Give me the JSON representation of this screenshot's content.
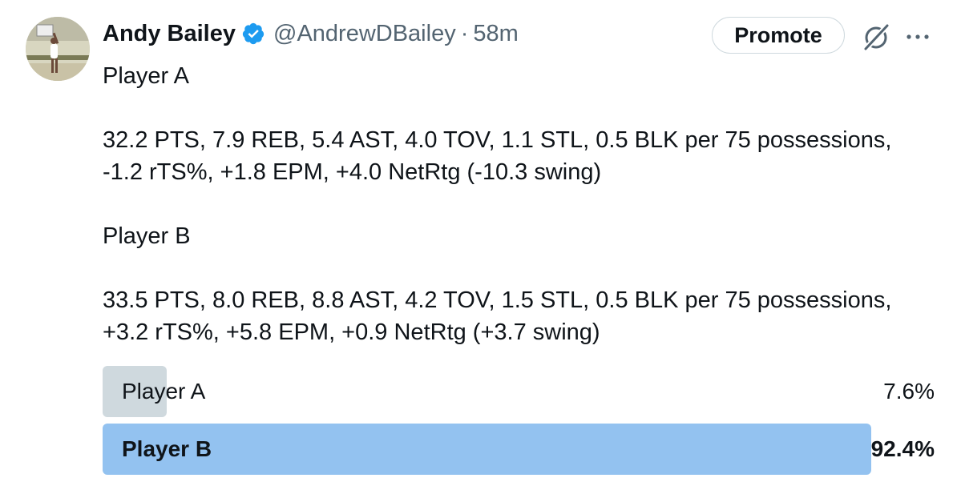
{
  "author": {
    "name": "Andy Bailey",
    "handle": "@AndrewDBailey",
    "separator": "·",
    "time": "58m",
    "verified": true,
    "verified_color": "#1d9bf0"
  },
  "actions": {
    "promote_label": "Promote",
    "grok_icon": "grok-icon",
    "more_icon": "more-icon"
  },
  "tweet": {
    "lines": [
      "Player A",
      "",
      "32.2 PTS, 7.9 REB, 5.4 AST, 4.0 TOV, 1.1 STL, 0.5 BLK per 75 possessions,",
      "-1.2 rTS%, +1.8 EPM, +4.0 NetRtg (-10.3 swing)",
      "",
      "Player B",
      "",
      "33.5 PTS, 8.0 REB, 8.8 AST, 4.2 TOV, 1.5 STL, 0.5 BLK per 75 possessions,",
      "+3.2 rTS%, +5.8 EPM, +0.9 NetRtg (+3.7 swing)"
    ]
  },
  "poll": {
    "options": [
      {
        "label": "Player A",
        "percent_text": "7.6%",
        "fraction": 0.076,
        "winner": false
      },
      {
        "label": "Player B",
        "percent_text": "92.4%",
        "fraction": 0.924,
        "winner": true
      }
    ],
    "colors": {
      "loser": "#cfd9de",
      "winner": "#93c2f0"
    }
  }
}
